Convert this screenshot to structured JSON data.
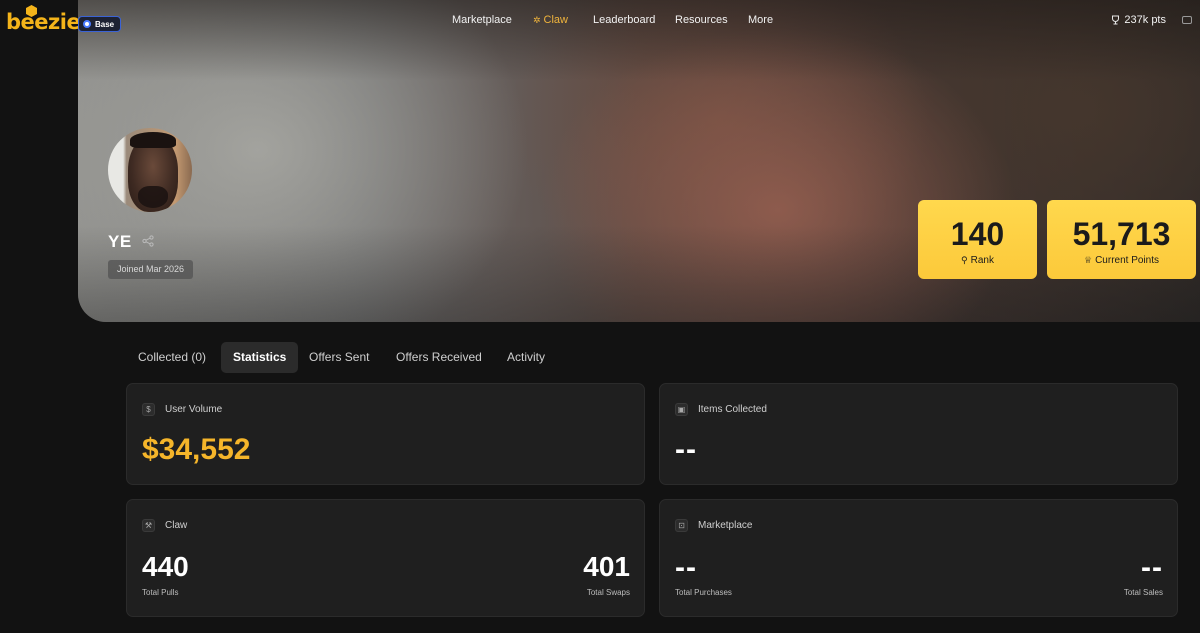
{
  "header": {
    "logo_text": "beezie",
    "chain_badge": "Base",
    "nav": [
      {
        "label": "Marketplace"
      },
      {
        "label": "Claw",
        "icon": "claw-sparkle-icon",
        "active": true
      },
      {
        "label": "Leaderboard"
      },
      {
        "label": "Resources"
      },
      {
        "label": "More"
      }
    ],
    "points": "237k pts",
    "accent_color": "#f0b43c"
  },
  "profile": {
    "username": "YE",
    "joined": "Joined Mar 2026",
    "rank_value": "140",
    "rank_label": "Rank",
    "points_value": "51,713",
    "points_label": "Current Points"
  },
  "tabs": [
    {
      "label": "Collected (0)"
    },
    {
      "label": "Statistics",
      "active": true
    },
    {
      "label": "Offers Sent"
    },
    {
      "label": "Offers Received"
    },
    {
      "label": "Activity"
    }
  ],
  "panels": {
    "user_volume": {
      "title": "User Volume",
      "value": "$34,552",
      "icon": "dollar-icon"
    },
    "items_collected": {
      "title": "Items Collected",
      "value": "--",
      "icon": "lock-icon"
    },
    "claw": {
      "title": "Claw",
      "icon": "claw-icon",
      "left_value": "440",
      "left_label": "Total Pulls",
      "right_value": "401",
      "right_label": "Total Swaps"
    },
    "marketplace": {
      "title": "Marketplace",
      "icon": "bag-icon",
      "left_value": "--",
      "left_label": "Total Purchases",
      "right_value": "--",
      "right_label": "Total Sales"
    }
  }
}
